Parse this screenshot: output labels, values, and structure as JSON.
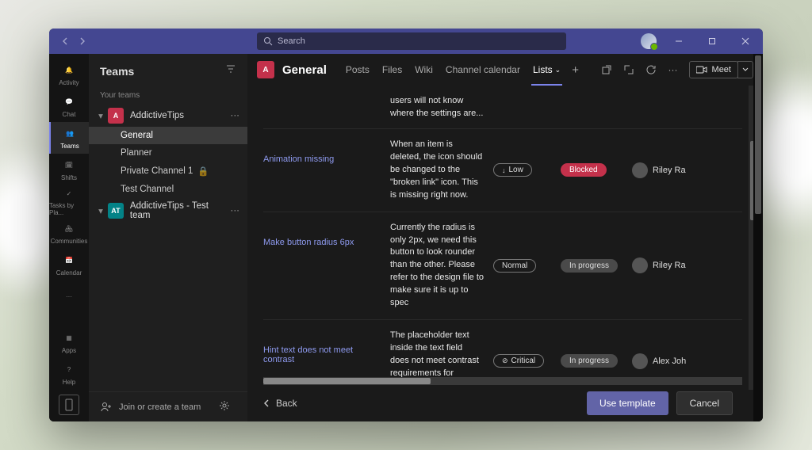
{
  "titlebar": {
    "search_placeholder": "Search"
  },
  "rail": [
    {
      "label": "Activity"
    },
    {
      "label": "Chat"
    },
    {
      "label": "Teams"
    },
    {
      "label": "Shifts"
    },
    {
      "label": "Tasks by Pla..."
    },
    {
      "label": "Communities"
    },
    {
      "label": "Calendar"
    }
  ],
  "rail_more": "···",
  "rail_apps": "Apps",
  "rail_help": "Help",
  "teams_panel": {
    "title": "Teams",
    "section": "Your teams",
    "teams": [
      {
        "name": "AddictiveTips",
        "avatar": "A",
        "avatar_class": "red",
        "channels": [
          {
            "name": "General",
            "active": true
          },
          {
            "name": "Planner"
          },
          {
            "name": "Private Channel 1",
            "locked": true
          },
          {
            "name": "Test Channel"
          }
        ]
      },
      {
        "name": "AddictiveTips - Test team",
        "avatar": "AT",
        "avatar_class": "teal",
        "channels": []
      }
    ],
    "footer": "Join or create a team"
  },
  "channel_header": {
    "avatar": "A",
    "title": "General",
    "tabs": [
      {
        "label": "Posts"
      },
      {
        "label": "Files"
      },
      {
        "label": "Wiki"
      },
      {
        "label": "Channel calendar"
      },
      {
        "label": "Lists",
        "active": true,
        "dropdown": true
      }
    ],
    "meet": "Meet"
  },
  "list": {
    "partial_desc": "users will not know where the settings are...",
    "rows": [
      {
        "title": "Animation missing",
        "desc": "When an item is deleted, the icon should be changed to the \"broken link\" icon. This is missing right now.",
        "priority": "Low",
        "priority_icon": "down",
        "status": "Blocked",
        "status_class": "blocked",
        "assignee": "Riley Ra"
      },
      {
        "title": "Make button radius 6px",
        "desc": "Currently the radius is only 2px, we need this button to look rounder than the other. Please refer to the design file to make sure it is up to spec",
        "priority": "Normal",
        "status": "In progress",
        "status_class": "progress",
        "assignee": "Riley Ra"
      },
      {
        "title": "Hint text does not meet contrast",
        "desc": "The placeholder text inside the text field does not meet contrast requirements for accessibility",
        "priority": "Critical",
        "priority_icon": "cross",
        "status": "In progress",
        "status_class": "progress",
        "assignee": "Alex Joh"
      }
    ]
  },
  "footer": {
    "back": "Back",
    "primary": "Use template",
    "secondary": "Cancel"
  }
}
